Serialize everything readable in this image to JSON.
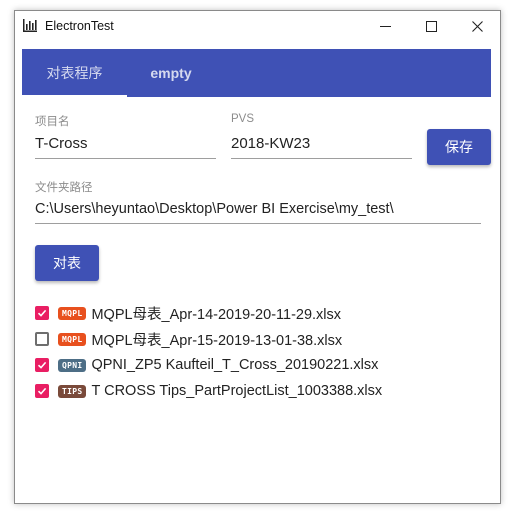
{
  "window": {
    "title": "ElectronTest"
  },
  "tabs": [
    {
      "label": "对表程序"
    },
    {
      "label": "empty"
    }
  ],
  "form": {
    "project": {
      "label": "项目名",
      "value": "T-Cross"
    },
    "pvs": {
      "label": "PVS",
      "value": "2018-KW23"
    },
    "save_label": "保存",
    "folder": {
      "label": "文件夹路径",
      "value": "C:\\Users\\heyuntao\\Desktop\\Power BI Exercise\\my_test\\"
    },
    "compare_label": "对表"
  },
  "files": [
    {
      "checked": true,
      "badge": "MQPL",
      "badge_color": "#e8501e",
      "name": "MQPL母表_Apr-14-2019-20-11-29.xlsx"
    },
    {
      "checked": false,
      "badge": "MQPL",
      "badge_color": "#e8501e",
      "name": "MQPL母表_Apr-15-2019-13-01-38.xlsx"
    },
    {
      "checked": true,
      "badge": "QPNI",
      "badge_color": "#4d6e86",
      "name": "QPNI_ZP5 Kaufteil_T_Cross_20190221.xlsx"
    },
    {
      "checked": true,
      "badge": "TIPS",
      "badge_color": "#7a4a3a",
      "name": "T CROSS Tips_PartProjectList_1003388.xlsx"
    }
  ],
  "colors": {
    "primary": "#3f51b5",
    "checkbox": "#e91e63"
  },
  "icons": {
    "app": "bar-chart-icon",
    "minimize": "minimize-icon",
    "maximize": "maximize-icon",
    "close": "close-icon"
  }
}
